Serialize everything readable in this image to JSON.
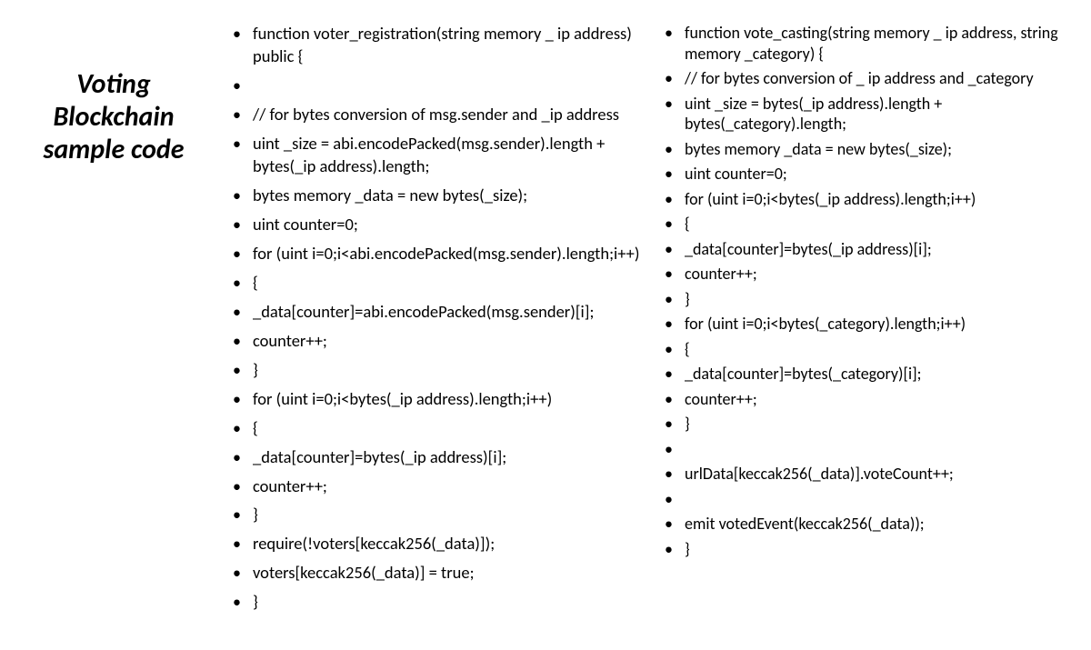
{
  "title": "Voting Blockchain sample code",
  "left_code": [
    "function voter_registration(string memory _ ip address) public {",
    "",
    "// for bytes conversion of msg.sender and _ip address",
    "uint _size = abi.encodePacked(msg.sender).length + bytes(_ip address).length;",
    "bytes memory _data = new bytes(_size);",
    "uint counter=0;",
    "for (uint i=0;i<abi.encodePacked(msg.sender).length;i++)",
    "{",
    " _data[counter]=abi.encodePacked(msg.sender)[i];",
    " counter++;",
    "}",
    " for (uint i=0;i<bytes(_ip address).length;i++)",
    "{",
    " _data[counter]=bytes(_ip address)[i];",
    " counter++;",
    "}",
    "require(!voters[keccak256(_data)]);",
    " voters[keccak256(_data)] = true;",
    "}"
  ],
  "right_code": [
    "function vote_casting(string memory _ ip address, string memory _category) {",
    "// for bytes conversion of _ ip address and _category",
    "uint _size = bytes(_ip address).length + bytes(_category).length;",
    "bytes memory _data = new bytes(_size);",
    "uint counter=0;",
    "for (uint i=0;i<bytes(_ip address).length;i++)",
    "{",
    "  _data[counter]=bytes(_ip address)[i];",
    "  counter++;",
    "}",
    "for (uint i=0;i<bytes(_category).length;i++)",
    "{",
    "   _data[counter]=bytes(_category)[i];",
    "   counter++;",
    "}",
    "",
    "  urlData[keccak256(_data)].voteCount++;",
    "",
    "  emit votedEvent(keccak256(_data));",
    "}"
  ]
}
